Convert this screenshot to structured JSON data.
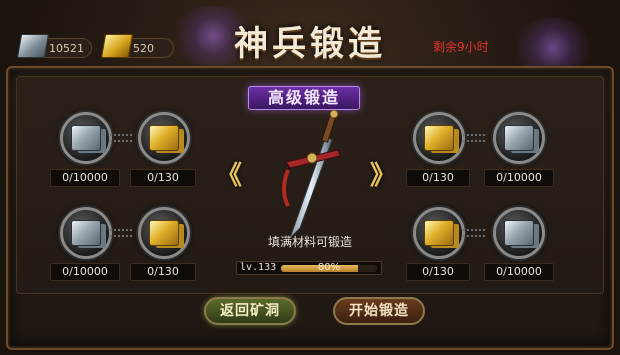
{
  "resources": {
    "silver": {
      "icon": "silver-ingot-icon",
      "value": "10521"
    },
    "gold": {
      "icon": "gold-ingot-icon",
      "value": "520"
    }
  },
  "header": {
    "title": "神兵锻造",
    "remaining": "剩余9小时"
  },
  "forge": {
    "tag": "高级锻造",
    "prev_arrow": "《",
    "next_arrow": "》",
    "hint": "填满材料可锻造",
    "level": "lv.133",
    "progress_text": "80%",
    "progress": 0.8
  },
  "slots": {
    "left_top_silver": "0/10000",
    "left_top_gold": "0/130",
    "left_bottom_silver": "0/10000",
    "left_bottom_gold": "0/130",
    "right_top_gold": "0/130",
    "right_top_silver": "0/10000",
    "right_bottom_gold": "0/130",
    "right_bottom_silver": "0/10000"
  },
  "buttons": {
    "back": "返回矿洞",
    "start": "开始锻造"
  },
  "colors": {
    "remaining": "#e2332a",
    "tag_bg": "#6b2fa6",
    "progress_fill": "#e6b85c"
  }
}
